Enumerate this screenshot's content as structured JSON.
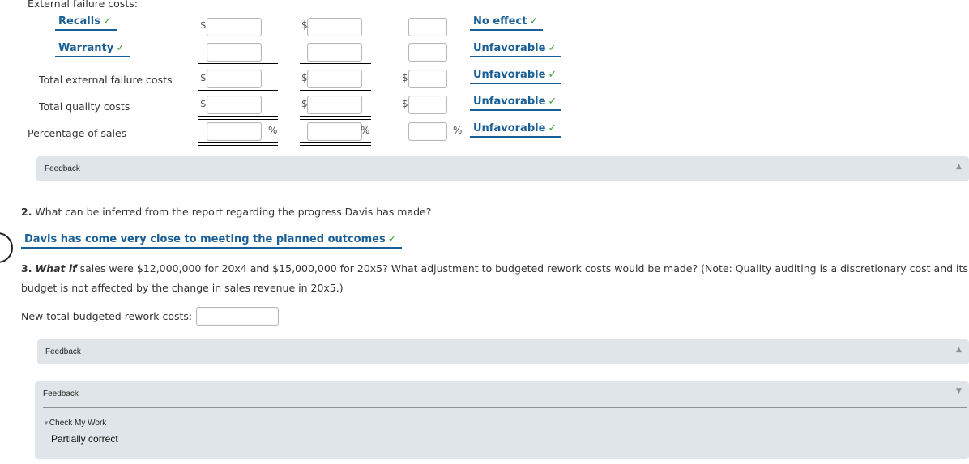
{
  "section_heading": "External failure costs:",
  "rows": [
    {
      "label": "Recalls",
      "type": "select",
      "col_effect": "No effect"
    },
    {
      "label": "Warranty",
      "type": "select",
      "col_effect": "Unfavorable"
    },
    {
      "label": "Total external failure costs",
      "type": "text",
      "col_effect": "Unfavorable"
    },
    {
      "label": "Total quality costs",
      "type": "text",
      "col_effect": "Unfavorable"
    },
    {
      "label": "Percentage of sales",
      "type": "text",
      "col_effect": "Unfavorable"
    }
  ],
  "symbols": {
    "currency": "$",
    "percent": "%",
    "check": "✓"
  },
  "feedback1": {
    "label": "Feedback",
    "icon": "collapse-up-icon"
  },
  "q2": {
    "number": "2.",
    "text": " What can be inferred from the report regarding the progress Davis has made?",
    "answer": "Davis has come very close to meeting the planned outcomes"
  },
  "q3": {
    "number": "3.",
    "whatif": "What if",
    "text": " sales were $12,000,000 for 20x4 and $15,000,000 for 20x5? What adjustment to budgeted rework costs would be made? (Note: Quality auditing is a discretionary cost and its",
    "text_line2": "budget is not affected by the change in sales revenue in 20x5.)",
    "input_label": "New total budgeted rework costs: $",
    "input_value": ""
  },
  "feedback2": {
    "label": "Feedback"
  },
  "feedback3": {
    "label": "Feedback",
    "check_my_work": "Check My Work",
    "status": "Partially correct"
  }
}
